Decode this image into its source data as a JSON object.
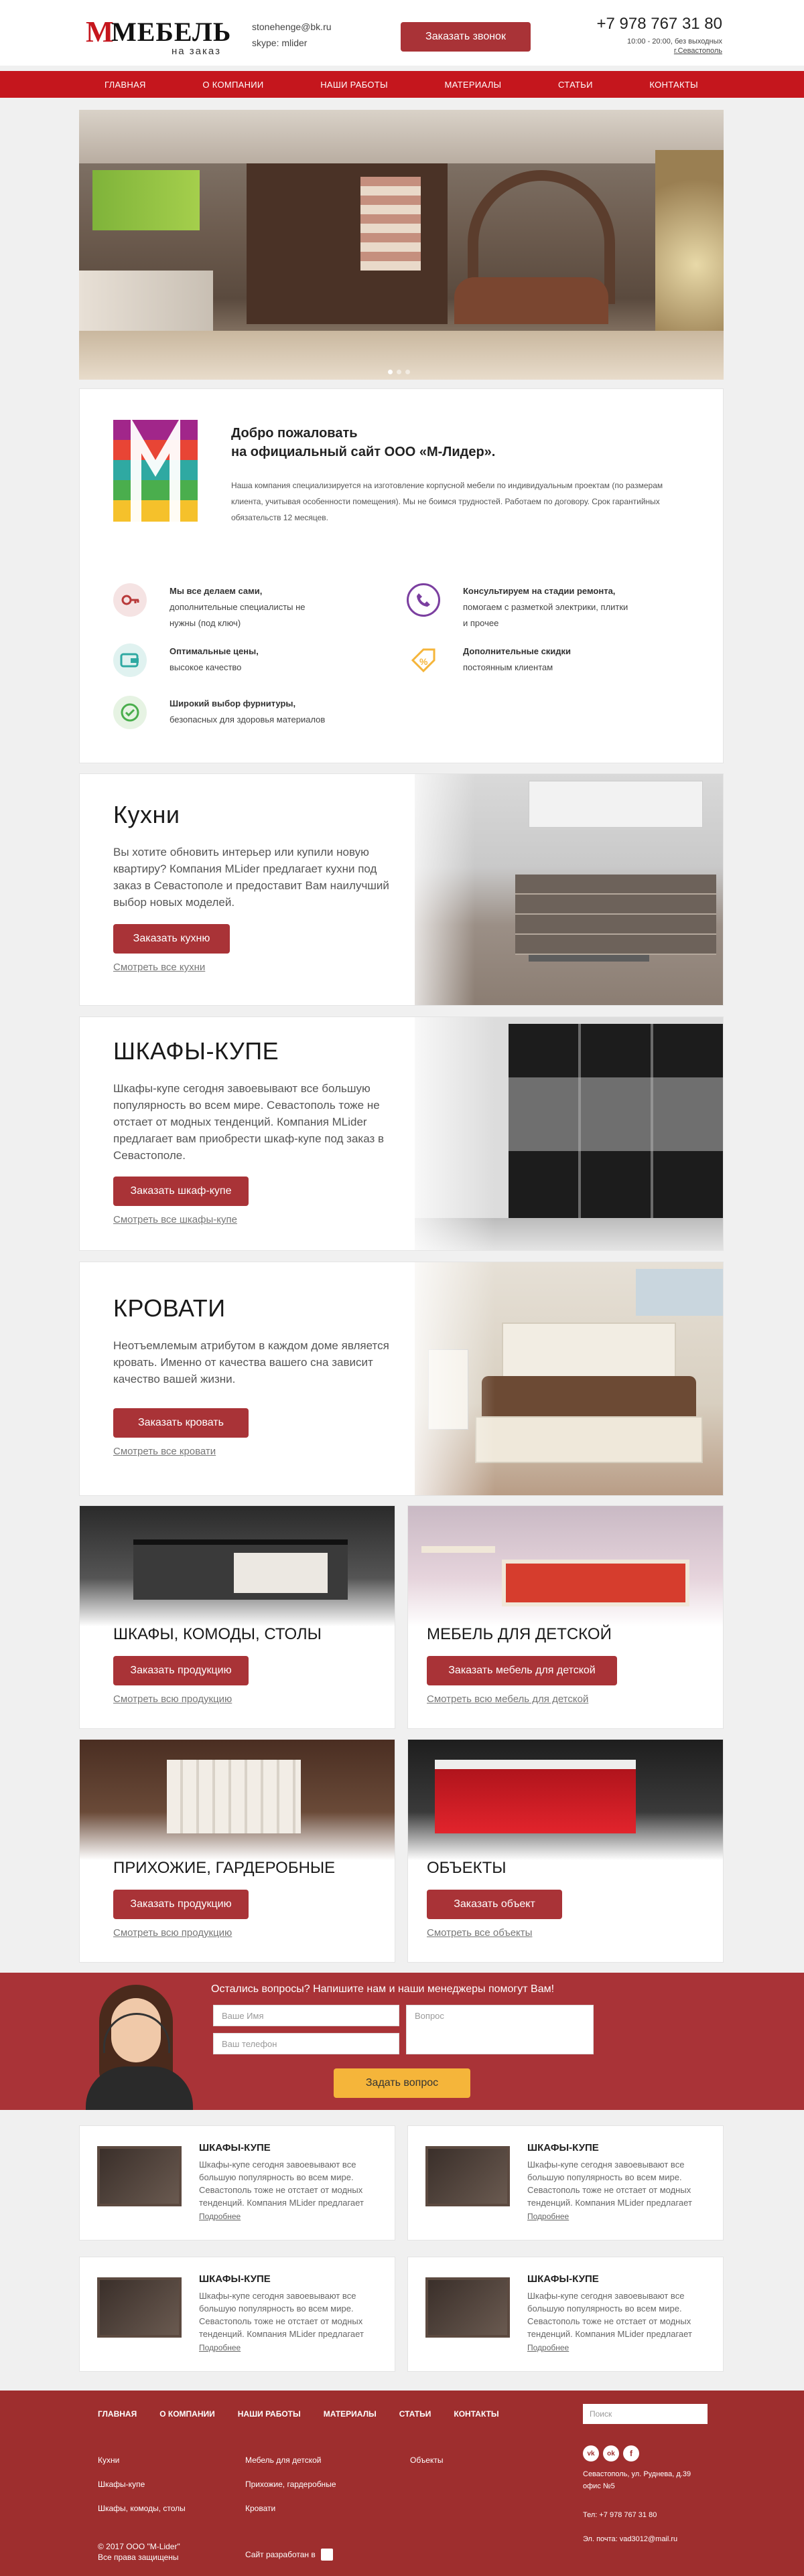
{
  "header": {
    "logo_letter": "М",
    "logo_word": "МЕБЕЛЬ",
    "logo_sub": "на заказ",
    "email": "stonehenge@bk.ru",
    "skype": "skype: mlider",
    "callback_button": "Заказать звонок",
    "phone": "+7 978 767 31 80",
    "hours": "10:00 - 20:00, без выходных",
    "city": "г.Севастополь"
  },
  "nav": [
    "ГЛАВНАЯ",
    "О КОМПАНИИ",
    "НАШИ РАБОТЫ",
    "МАТЕРИАЛЫ",
    "СТАТЬИ",
    "КОНТАКТЫ"
  ],
  "welcome": {
    "title1": "Добро пожаловать",
    "title2": "на официальный сайт ООО «М-Лидер».",
    "body": "Наша компания специализируется на изготовление корпусной мебели по индивидуальным проектам (по размерам клиента, учитывая особенности помещения). Мы не боимся трудностей. Работаем по договору. Срок гарантийных обязательств 12 месяцев.",
    "features": [
      {
        "icon": "key-icon",
        "title": "Мы все делаем сами,",
        "text": "дополнительные специалисты не нужны (под ключ)"
      },
      {
        "icon": "phone-icon",
        "title": "Консультируем на стадии ремонта,",
        "text": "помогаем с разметкой электрики, плитки и прочее"
      },
      {
        "icon": "wallet-icon",
        "title": "Оптимальные цены,",
        "text": "высокое качество"
      },
      {
        "icon": "discount-tag-icon",
        "title": "Дополнительные скидки",
        "text": "постоянным клиентам"
      },
      {
        "icon": "check-icon",
        "title": "Широкий выбор фурнитуры,",
        "text": "безопасных для здоровья материалов"
      }
    ]
  },
  "products": [
    {
      "title": "Кухни",
      "text": "Вы хотите обновить интерьер или купили новую квартиру? Компания MLider предлагает кухни под заказ в Севастополе и предоставит Вам наилучший выбор новых моделей.",
      "button": "Заказать кухню",
      "link": "Смотреть все кухни"
    },
    {
      "title": "ШКАФЫ-КУПЕ",
      "text": "Шкафы-купе сегодня завоевывают все большую популярность во всем мире. Севастополь тоже не отстает от модных тенденций. Компания MLider предлагает вам приобрести шкаф-купе под заказ в Севастополе.",
      "button": "Заказать шкаф-купе",
      "link": "Смотреть все шкафы-купе"
    },
    {
      "title": "КРОВАТИ",
      "text": "Неотъемлемым атрибутом в каждом доме является кровать. Именно от качества вашего сна зависит качество вашей жизни.",
      "button": "Заказать кровать",
      "link": "Смотреть все кровати"
    }
  ],
  "tiles": [
    {
      "title": "ШКАФЫ, КОМОДЫ, СТОЛЫ",
      "button": "Заказать продукцию",
      "link": "Смотреть всю продукцию"
    },
    {
      "title": "МЕБЕЛЬ ДЛЯ ДЕТСКОЙ",
      "button": "Заказать мебель для детской",
      "link": "Смотреть всю мебель для детской"
    },
    {
      "title": "ПРИХОЖИЕ, ГАРДЕРОБНЫЕ",
      "button": "Заказать продукцию",
      "link": "Смотреть всю продукцию"
    },
    {
      "title": "ОБЪЕКТЫ",
      "button": "Заказать объект",
      "link": "Смотреть все объекты"
    }
  ],
  "form": {
    "title": "Остались вопросы? Напишите нам и наши менеджеры помогут Вам!",
    "name_placeholder": "Ваше Имя",
    "phone_placeholder": "Ваш телефон",
    "question_placeholder": "Вопрос",
    "submit": "Задать вопрос"
  },
  "articles": [
    {
      "title": "ШКАФЫ-КУПЕ",
      "text": "Шкафы-купе сегодня завоевывают все большую популярность во всем мире. Севастополь тоже не отстает от модных тенденций. Компания MLider предлагает",
      "link": "Подробнее"
    },
    {
      "title": "ШКАФЫ-КУПЕ",
      "text": "Шкафы-купе сегодня завоевывают все большую популярность во всем мире. Севастополь тоже не отстает от модных тенденций. Компания MLider предлагает",
      "link": "Подробнее"
    },
    {
      "title": "ШКАФЫ-КУПЕ",
      "text": "Шкафы-купе сегодня завоевывают все большую популярность во всем мире. Севастополь тоже не отстает от модных тенденций. Компания MLider предлагает",
      "link": "Подробнее"
    },
    {
      "title": "ШКАФЫ-КУПЕ",
      "text": "Шкафы-купе сегодня завоевывают все большую популярность во всем мире. Севастополь тоже не отстает от модных тенденций. Компания MLider предлагает",
      "link": "Подробнее"
    }
  ],
  "footer": {
    "nav": [
      "ГЛАВНАЯ",
      "О КОМПАНИИ",
      "НАШИ РАБОТЫ",
      "МАТЕРИАЛЫ",
      "СТАТЬИ",
      "КОНТАКТЫ"
    ],
    "search_placeholder": "Поиск",
    "col1": [
      "Кухни",
      "Шкафы-купе",
      "Шкафы, комоды, столы"
    ],
    "col2": [
      "Мебель для детской",
      "Прихожие, гардеробные",
      "Кровати"
    ],
    "col3": [
      "Объекты"
    ],
    "address": "Севастополь, ул. Руднева, д.39 офис №5",
    "phone": "Тел: +7 978 767 31 80",
    "email": "Эл. почта: vad3012@mail.ru",
    "copyright": "© 2017 ООО \"М-Lider\"",
    "rights": "Все права защищены",
    "dev": "Сайт разработан в",
    "social": [
      "vk-icon",
      "odnoklassniki-icon",
      "facebook-icon"
    ]
  },
  "colors": {
    "brand": "#c5161d",
    "button": "#a93337",
    "accent": "#f5b53a",
    "footer": "#9e2e2e"
  }
}
